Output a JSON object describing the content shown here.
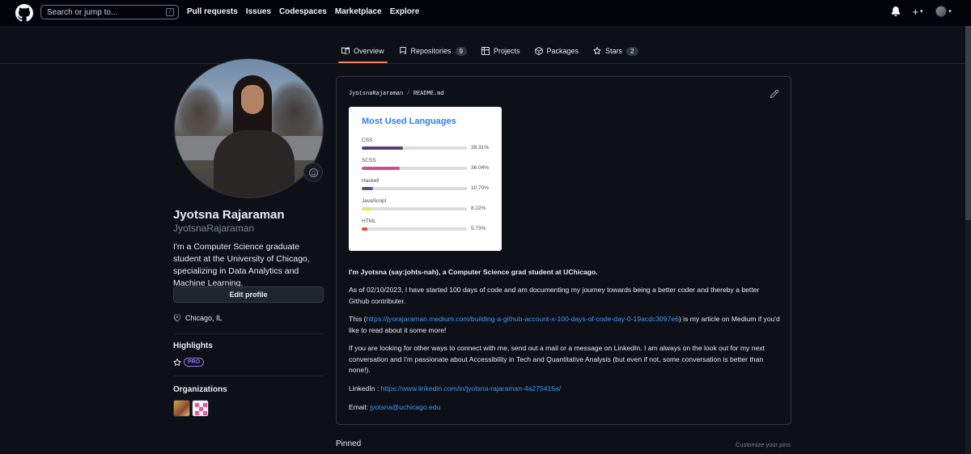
{
  "header": {
    "logo_icon": "github-mark-icon",
    "search_placeholder": "Search or jump to...",
    "search_shortcut": "/",
    "nav": [
      "Pull requests",
      "Issues",
      "Codespaces",
      "Marketplace",
      "Explore"
    ]
  },
  "tabs": [
    {
      "label": "Overview",
      "icon": "book-icon",
      "active": true,
      "count": ""
    },
    {
      "label": "Repositories",
      "icon": "repo-icon",
      "active": false,
      "count": "9"
    },
    {
      "label": "Projects",
      "icon": "table-icon",
      "active": false,
      "count": ""
    },
    {
      "label": "Packages",
      "icon": "package-icon",
      "active": false,
      "count": ""
    },
    {
      "label": "Stars",
      "icon": "star-icon",
      "active": false,
      "count": "2"
    }
  ],
  "profile": {
    "name": "Jyotsna Rajaraman",
    "login": "JyotsnaRajaraman",
    "bio": "I'm a Computer Science graduate student at the University of Chicago, specializing in Data Analytics and Machine Learning.",
    "edit_label": "Edit profile",
    "location": "Chicago, IL",
    "highlights_title": "Highlights",
    "pro_badge": "PRO",
    "orgs_title": "Organizations"
  },
  "readme": {
    "owner": "JyotsnaRajaraman",
    "sep": "/",
    "file": "README.md",
    "languages_title": "Most Used Languages",
    "languages": [
      {
        "name": "CSS",
        "percent": 39.31,
        "label": "39.31%",
        "color": "#563d7c"
      },
      {
        "name": "SCSS",
        "percent": 36.04,
        "label": "36.04%",
        "color": "#c6538c"
      },
      {
        "name": "Haskell",
        "percent": 10.7,
        "label": "10.70%",
        "color": "#5e5086"
      },
      {
        "name": "JavaScript",
        "percent": 8.22,
        "label": "8.22%",
        "color": "#f1e05a"
      },
      {
        "name": "HTML",
        "percent": 5.73,
        "label": "5.73%",
        "color": "#e34c26"
      }
    ],
    "intro": "I'm Jyotsna (say:johts-nah), a Computer Science grad student at UChicago.",
    "p1": "As of 02/10/2023, I have started 100 days of code and am documenting my journey towards being a better coder and thereby a better Github contributer.",
    "p2_before": "This (",
    "p2_link": "https://jyorajaraman.medium.com/building-a-github-account-x-100-days-of-code-day-0-19acdc3097e6",
    "p2_after": ") is my article on Medium if you'd like to read about it some more!",
    "p3": "If you are looking for other ways to connect with me, send out a mail or a message on LinkedIn. I am always on the look out for my next conversation and I'm passionate about Accessibility in Tech and Quantitative Analysis (but even if not, some conversation is better than none!).",
    "linkedin_label": "LinkedIn : ",
    "linkedin_url": "https://www.linkedin.com/in/jyotsna-rajaraman-4a275416a/",
    "email_label": "Email: ",
    "email": "jyotsna@uchicago.edu"
  },
  "pinned_label": "Pinned",
  "customize_pins_label": "Customize your pins"
}
